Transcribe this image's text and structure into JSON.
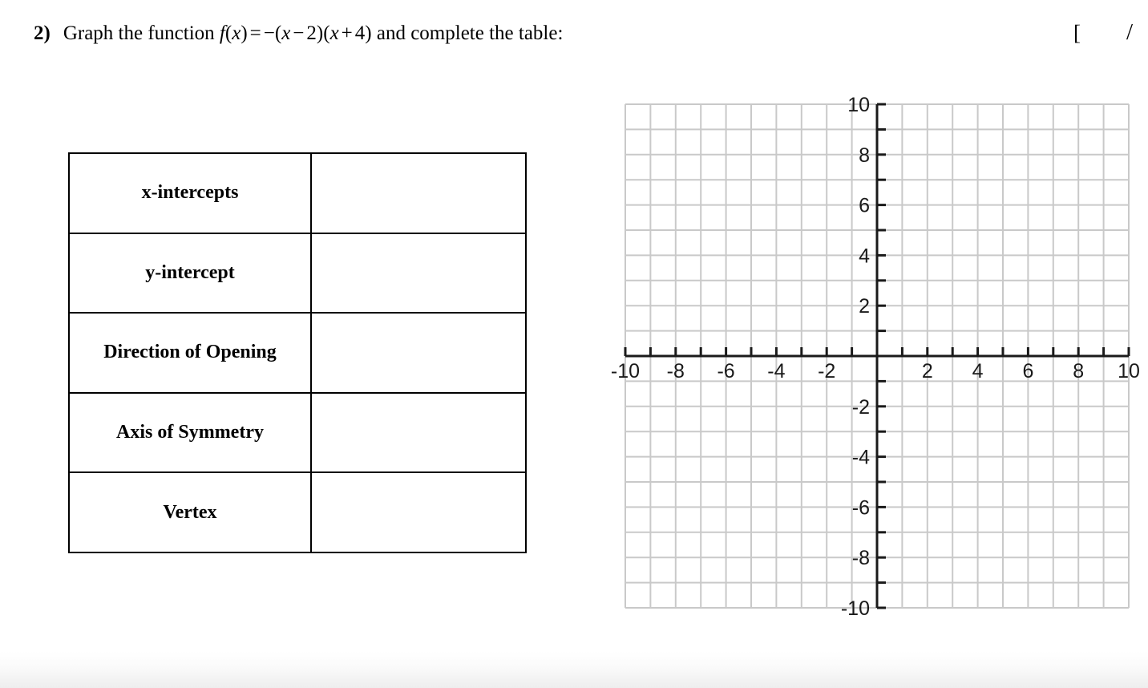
{
  "question": {
    "number": "2)",
    "prefix": "Graph the function",
    "function_expression": "f(x) = -(x - 2)(x + 4)",
    "function_parts": {
      "f": "f",
      "open1": "(",
      "x1": "x",
      "close1": ")",
      "equals": "=",
      "minus": "−",
      "open2": "(",
      "x2": "x",
      "minus2": "−",
      "two": "2",
      "close2": ")",
      "open3": "(",
      "x3": "x",
      "plus": "+",
      "four": "4",
      "close3": ")"
    },
    "suffix": "and complete the table:"
  },
  "score": {
    "bracket": "[",
    "slash": "/"
  },
  "table": {
    "rows": [
      {
        "label": "x-intercepts",
        "value": ""
      },
      {
        "label": "y-intercept",
        "value": ""
      },
      {
        "label": "Direction of Opening",
        "value": ""
      },
      {
        "label": "Axis of Symmetry",
        "value": ""
      },
      {
        "label": "Vertex",
        "value": ""
      }
    ]
  },
  "chart_data": {
    "type": "scatter",
    "title": "",
    "xlabel": "",
    "ylabel": "",
    "xlim": [
      -10,
      10
    ],
    "ylim": [
      -10,
      10
    ],
    "grid": true,
    "grid_step": 1,
    "tick_step": 1,
    "legend": "none",
    "x_tick_labels": [
      "-10",
      "-8",
      "-6",
      "-4",
      "-2",
      "2",
      "4",
      "6",
      "8",
      "10"
    ],
    "x_tick_values": [
      -10,
      -8,
      -6,
      -4,
      -2,
      2,
      4,
      6,
      8,
      10
    ],
    "y_tick_labels": [
      "10",
      "8",
      "6",
      "4",
      "2",
      "-2",
      "-4",
      "-6",
      "-8",
      "-10"
    ],
    "y_tick_values": [
      10,
      8,
      6,
      4,
      2,
      -2,
      -4,
      -6,
      -8,
      -10
    ],
    "series": [],
    "colors": {
      "grid_line": "#c9c9c9",
      "axis_line": "#1a1a1a",
      "tick_label": "#1a1a1a",
      "background": "#ffffff"
    },
    "note": "Empty coordinate grid provided for student to graph f(x) = -(x-2)(x+4)"
  }
}
